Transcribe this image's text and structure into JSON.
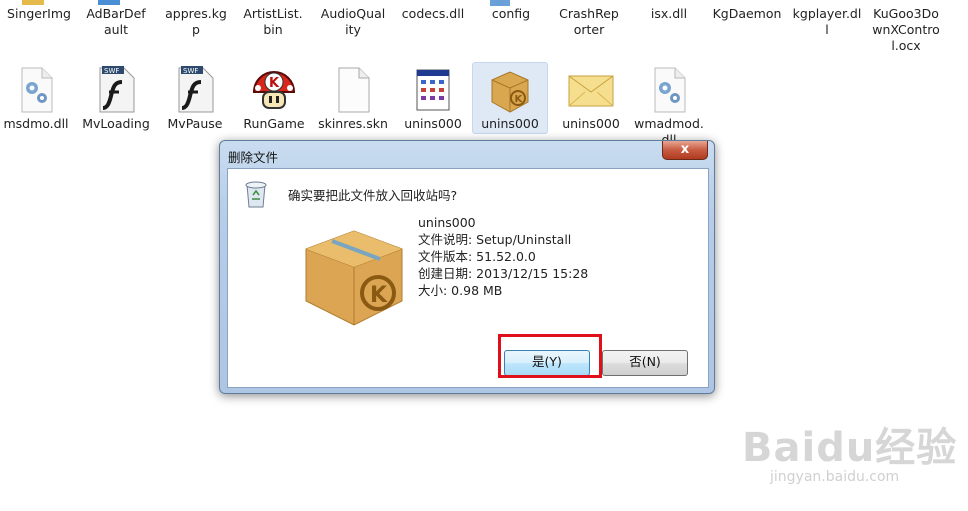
{
  "row1": [
    {
      "label": "SingerImg"
    },
    {
      "label": "AdBarDefault"
    },
    {
      "label": "appres.kgp"
    },
    {
      "label": "ArtistList.bin"
    },
    {
      "label": "AudioQuality"
    },
    {
      "label": "codecs.dll"
    },
    {
      "label": "config"
    },
    {
      "label": "CrashReporter"
    },
    {
      "label": "isx.dll"
    },
    {
      "label": "KgDaemon"
    },
    {
      "label": "kgplayer.dll"
    },
    {
      "label": "KuGoo3DownXControl.ocx"
    }
  ],
  "row2": [
    {
      "label": "msdmo.dll",
      "icon": "dll-gear-icon"
    },
    {
      "label": "MvLoading",
      "icon": "swf-icon",
      "badge": "SWF"
    },
    {
      "label": "MvPause",
      "icon": "swf-icon",
      "badge": "SWF"
    },
    {
      "label": "RunGame",
      "icon": "mushroom-icon",
      "badge": "K"
    },
    {
      "label": "skinres.skn",
      "icon": "blank-file-icon"
    },
    {
      "label": "unins000",
      "icon": "app-window-icon"
    },
    {
      "label": "unins000",
      "icon": "kugou-box-icon"
    },
    {
      "label": "unins000",
      "icon": "envelope-icon"
    },
    {
      "label": "wmadmod.dll",
      "icon": "dll-gear-icon"
    }
  ],
  "dialog": {
    "title": "删除文件",
    "close": "x",
    "question": "确实要把此文件放入回收站吗?",
    "file_name": "unins000",
    "description": "文件说明: Setup/Uninstall",
    "version": "文件版本: 51.52.0.0",
    "created": "创建日期: 2013/12/15 15:28",
    "size": "大小: 0.98 MB",
    "yes_label": "是(Y)",
    "no_label": "否(N)"
  },
  "watermark": {
    "brand": "Baidu经验",
    "url": "jingyan.baidu.com"
  },
  "colors": {
    "highlight_box": "#e0101a",
    "title_bar": "#b6cde8",
    "close_button": "#c75c42"
  }
}
